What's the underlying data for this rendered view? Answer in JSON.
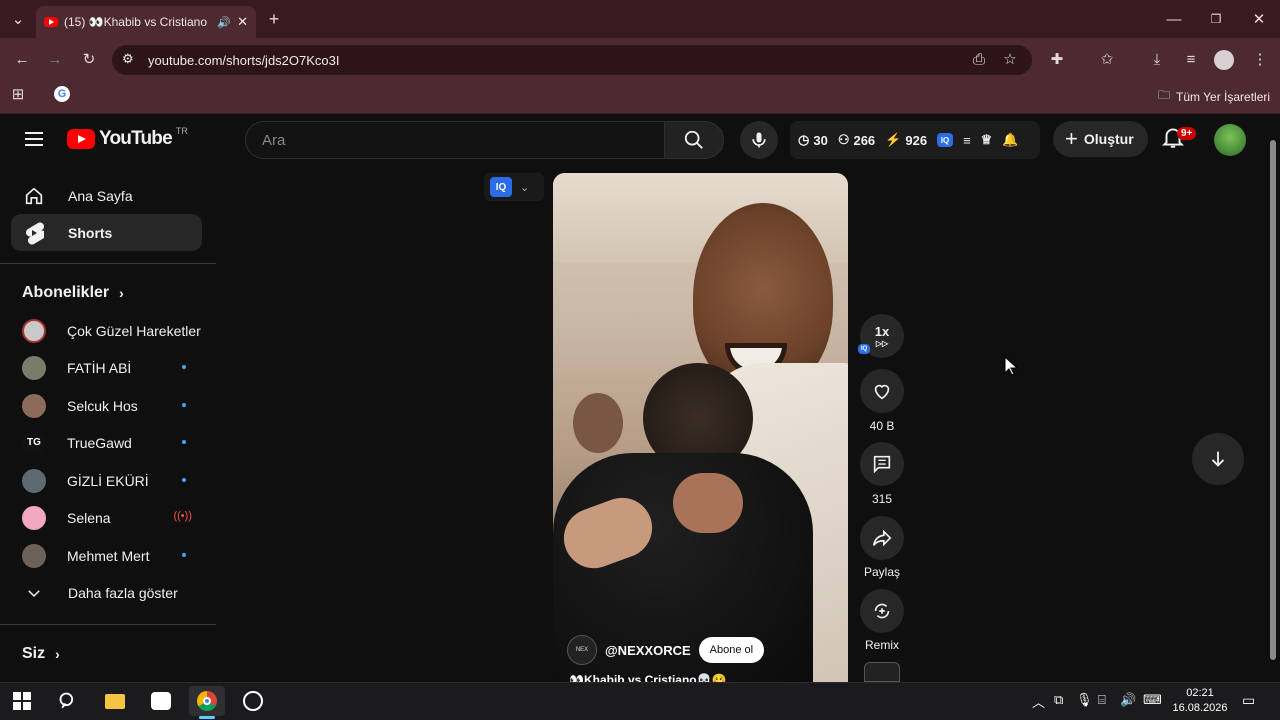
{
  "browser": {
    "tab_title": "(15) 👀Khabib vs Cristiano",
    "new_tab": "+",
    "url": "youtube.com/shorts/jds2O7Kco3I",
    "bookmarks_label": "Tüm Yer İşaretleri",
    "window_controls": [
      "minimize-icon",
      "restore-icon",
      "close-icon"
    ]
  },
  "header": {
    "logo_text": "YouTube",
    "logo_region": "TR",
    "search_placeholder": "Ara",
    "stats": {
      "clock": "30",
      "users": "266",
      "coins": "926"
    },
    "create_label": "Oluştur",
    "notif_badge": "9+"
  },
  "sidebar": {
    "nav": [
      {
        "label": "Ana Sayfa",
        "icon": "home-icon"
      },
      {
        "label": "Shorts",
        "icon": "shorts-icon",
        "active": true
      }
    ],
    "subs_header": "Abonelikler",
    "subscriptions": [
      {
        "name": "Çok Güzel Hareketler",
        "color": "#c9c9c9"
      },
      {
        "name": "FATİH ABİ",
        "color": "#7b7b6a"
      },
      {
        "name": "Selcuk Hos",
        "color": "#8d6b5a"
      },
      {
        "name": "TrueGawd",
        "color": "#111111"
      },
      {
        "name": "GİZLİ EKÜRİ",
        "color": "#5d6a72"
      },
      {
        "name": "Selena",
        "color": "#f2a7c3"
      },
      {
        "name": "Mehmet Mert",
        "color": "#6d6259"
      }
    ],
    "show_more": "Daha fazla göster",
    "you_header": "Siz"
  },
  "short": {
    "speed": "1x",
    "likes": "40 B",
    "comments": "315",
    "share": "Paylaş",
    "remix": "Remix",
    "channel": "@NEXXORCE",
    "subscribe": "Abone ol",
    "caption": "👀Khabib vs Cristiano💀🥴"
  },
  "taskbar": {
    "time": "02:21",
    "date": "16.08.2026"
  }
}
